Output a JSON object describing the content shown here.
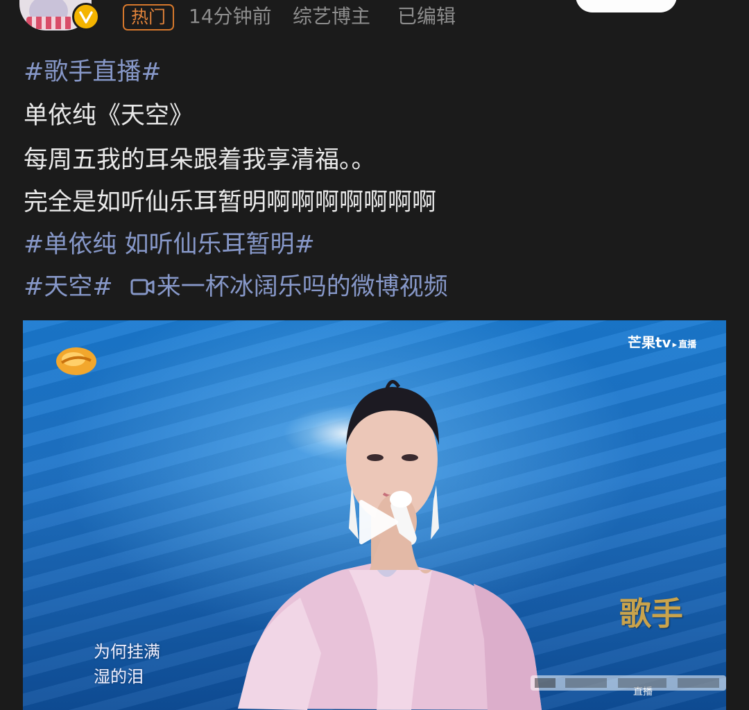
{
  "post_header": {
    "hot_tag": "热门",
    "time_ago": "14分钟前",
    "author_category": "综艺博主",
    "edit_status": "已编辑"
  },
  "post_body": {
    "topic_tag_1": "#歌手直播#",
    "line_1": "单依纯《天空》",
    "line_2": "每周五我的耳朵跟着我享清福。。",
    "line_3": "完全是如听仙乐耳暂明啊啊啊啊啊啊啊",
    "topic_tag_2": "#单依纯 如听仙乐耳暂明#",
    "topic_tag_3": "#天空#",
    "video_link_text": "来一杯冰阔乐吗的微博视频"
  },
  "video": {
    "platform_logo": "芒果tv",
    "platform_status": "直播",
    "subtitle_line_1": "为何挂满",
    "subtitle_line_2": "湿的泪",
    "show_logo": "歌手",
    "show_logo_sub": "直播",
    "icons": {
      "play": "play-icon",
      "video_link": "video-camera-icon"
    }
  },
  "colors": {
    "background": "#1b1b1b",
    "text": "#e9e9e9",
    "link": "#8798c9",
    "meta": "#8e8e8e",
    "hot_tag": "#e2833a",
    "verified_badge": "#f4b400"
  }
}
